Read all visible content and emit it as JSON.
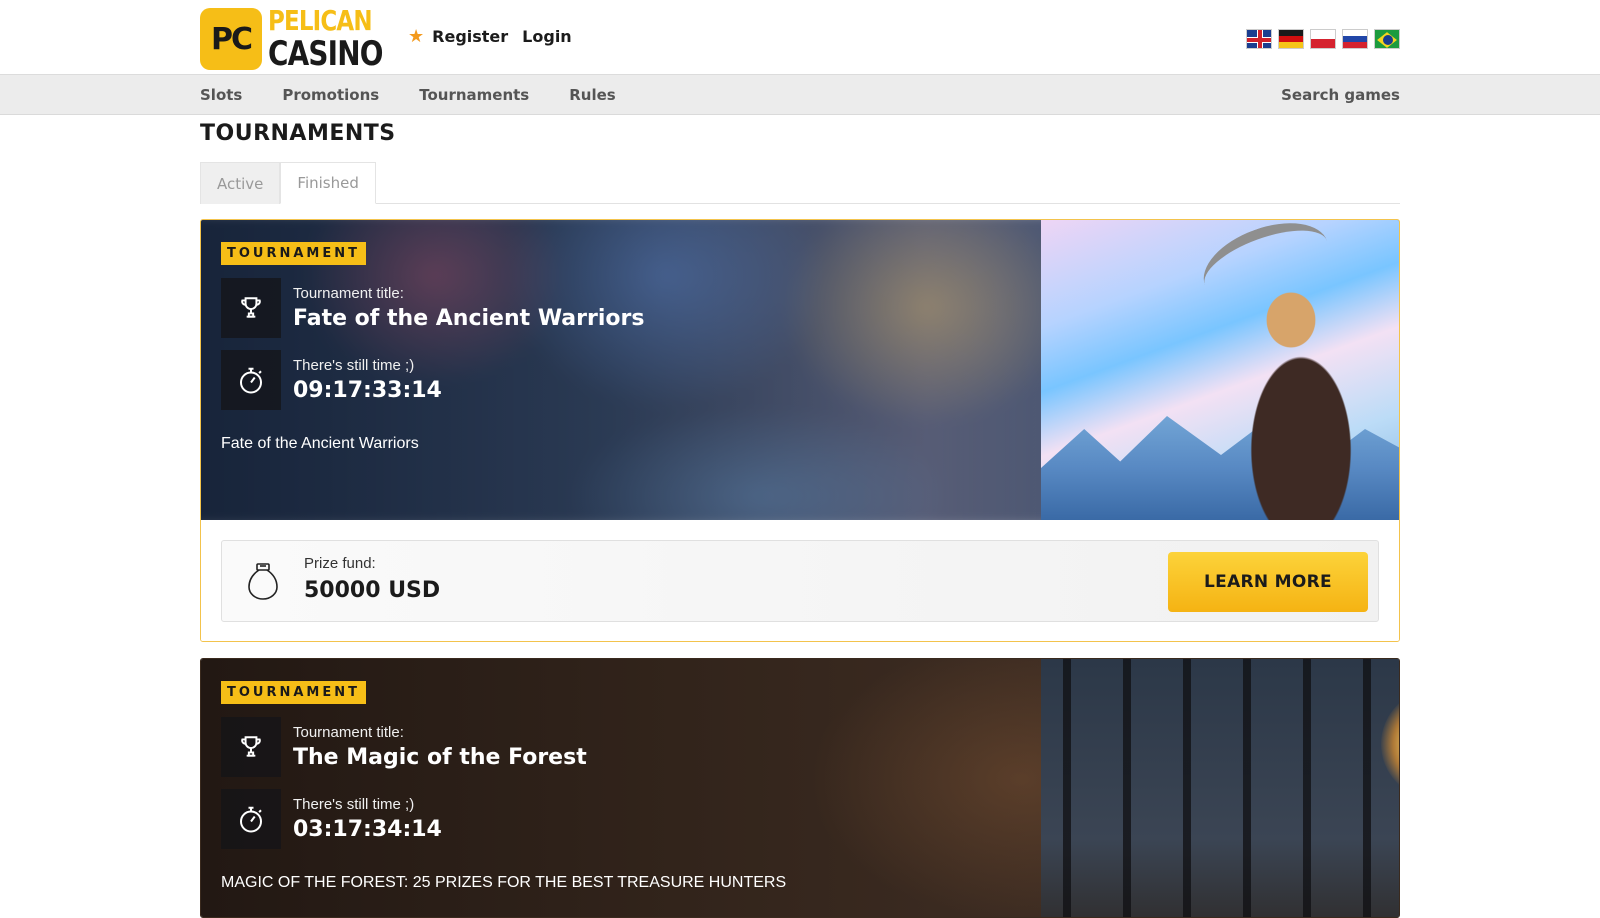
{
  "brand": {
    "logo_badge": "PC",
    "logo_line1": "PELICAN",
    "logo_line2": "CASINO"
  },
  "auth": {
    "register": "Register",
    "login": "Login"
  },
  "languages": [
    "en",
    "de",
    "pl",
    "ru",
    "br"
  ],
  "nav": {
    "items": [
      "Slots",
      "Promotions",
      "Tournaments",
      "Rules"
    ],
    "search": "Search games"
  },
  "page": {
    "title": "TOURNAMENTS"
  },
  "tabs": [
    "Active",
    "Finished"
  ],
  "tournaments": [
    {
      "tag": "TOURNAMENT",
      "title_label": "Tournament title:",
      "title": "Fate of the Ancient Warriors",
      "time_label": "There's still time ;)",
      "time": "09:17:33:14",
      "description": "Fate of the Ancient Warriors",
      "prize_label": "Prize fund:",
      "prize": "50000 USD",
      "button": "LEARN MORE"
    },
    {
      "tag": "TOURNAMENT",
      "title_label": "Tournament title:",
      "title": "The Magic of the Forest",
      "time_label": "There's still time ;)",
      "time": "03:17:34:14",
      "description": "MAGIC OF THE FOREST: 25 PRIZES FOR THE BEST TREASURE HUNTERS"
    }
  ],
  "colors": {
    "accent": "#f6be17",
    "button": "#f5b313",
    "nav_bg": "#ececec"
  }
}
